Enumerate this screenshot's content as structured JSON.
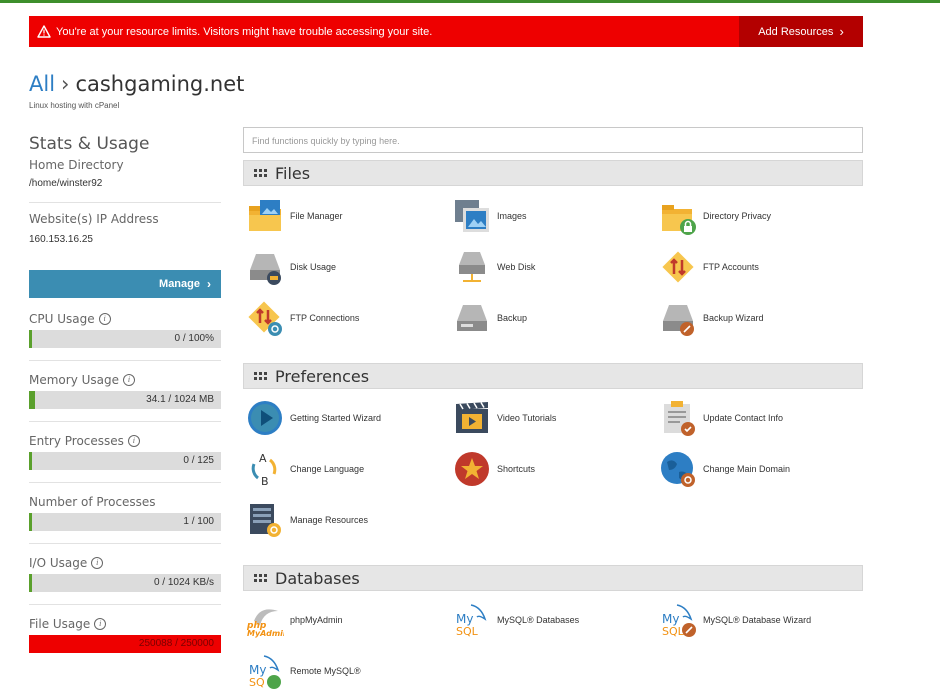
{
  "alert": {
    "message": "You're at your resource limits. Visitors might have trouble accessing your site.",
    "button": "Add Resources",
    "icon": "warning-icon"
  },
  "breadcrumb": {
    "root": "All",
    "domain": "cashgaming.net",
    "subtitle": "Linux hosting with cPanel"
  },
  "sidebar": {
    "title": "Stats & Usage",
    "home_label": "Home Directory",
    "home_value": "/home/winster92",
    "ip_label": "Website(s) IP Address",
    "ip_value": "160.153.16.25",
    "manage": "Manage",
    "metrics": [
      {
        "name": "CPU Usage",
        "info": true,
        "value": "0 / 100%",
        "fill": 0.0,
        "state": "ok"
      },
      {
        "name": "Memory Usage",
        "info": true,
        "value": "34.1 / 1024 MB",
        "fill": 0.033,
        "state": "ok"
      },
      {
        "name": "Entry Processes",
        "info": true,
        "value": "0 / 125",
        "fill": 0.0,
        "state": "ok"
      },
      {
        "name": "Number of Processes",
        "info": false,
        "value": "1 / 100",
        "fill": 0.01,
        "state": "ok"
      },
      {
        "name": "I/O Usage",
        "info": true,
        "value": "0 / 1024 KB/s",
        "fill": 0.0,
        "state": "ok"
      },
      {
        "name": "File Usage",
        "info": true,
        "value": "250088 / 250000",
        "fill": 1.0,
        "state": "over"
      }
    ]
  },
  "search": {
    "placeholder": "Find functions quickly by typing here."
  },
  "sections": {
    "files": "Files",
    "preferences": "Preferences",
    "databases": "Databases"
  },
  "files": [
    {
      "label": "File Manager",
      "icon": "file-manager-icon"
    },
    {
      "label": "Images",
      "icon": "images-icon"
    },
    {
      "label": "Directory Privacy",
      "icon": "directory-privacy-icon"
    },
    {
      "label": "Disk Usage",
      "icon": "disk-usage-icon"
    },
    {
      "label": "Web Disk",
      "icon": "web-disk-icon"
    },
    {
      "label": "FTP Accounts",
      "icon": "ftp-accounts-icon"
    },
    {
      "label": "FTP Connections",
      "icon": "ftp-connections-icon"
    },
    {
      "label": "Backup",
      "icon": "backup-icon"
    },
    {
      "label": "Backup Wizard",
      "icon": "backup-wizard-icon"
    }
  ],
  "preferences": [
    {
      "label": "Getting Started Wizard",
      "icon": "play-icon"
    },
    {
      "label": "Video Tutorials",
      "icon": "video-tutorials-icon"
    },
    {
      "label": "Update Contact Info",
      "icon": "contact-info-icon"
    },
    {
      "label": "Change Language",
      "icon": "change-language-icon"
    },
    {
      "label": "Shortcuts",
      "icon": "shortcuts-star-icon"
    },
    {
      "label": "Change Main Domain",
      "icon": "globe-icon"
    },
    {
      "label": "Manage Resources",
      "icon": "manage-resources-icon"
    }
  ],
  "databases": [
    {
      "label": "phpMyAdmin",
      "icon": "phpmyadmin-icon"
    },
    {
      "label": "MySQL® Databases",
      "icon": "mysql-icon"
    },
    {
      "label": "MySQL® Database Wizard",
      "icon": "mysql-wizard-icon"
    },
    {
      "label": "Remote MySQL®",
      "icon": "remote-mysql-icon"
    }
  ]
}
